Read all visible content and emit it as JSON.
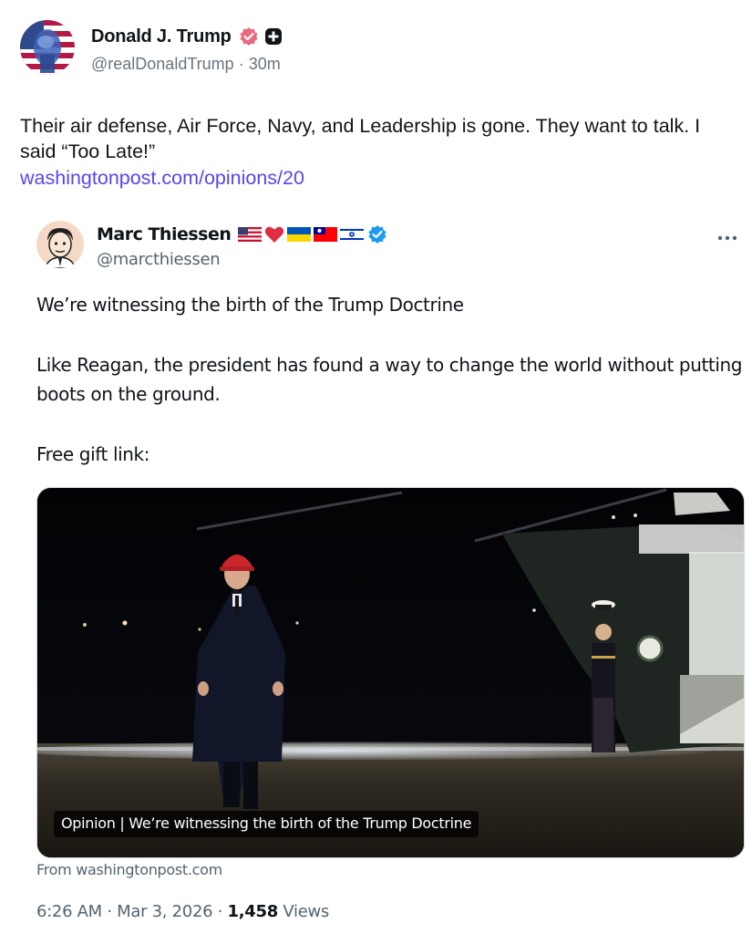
{
  "truth_post": {
    "author_name": "Donald J. Trump",
    "handle": "@realDonaldTrump",
    "separator": "·",
    "time_ago": "30m",
    "body": "Their air defense, Air Force, Navy, and Leadership is gone. They want to talk. I said “Too Late!”",
    "link_text": "washingtonpost.com/opinions/20",
    "icons": {
      "avatar": "flag-portrait-avatar",
      "verified": "verified-badge-icon",
      "extra": "plus-square-icon"
    },
    "colors": {
      "link": "#5448ee",
      "verified": "#e0245e"
    }
  },
  "quoted_post": {
    "author_name": "Marc Thiessen",
    "handle": "@marcthiessen",
    "flags": [
      "us-flag-icon",
      "red-heart-icon",
      "ukraine-flag-icon",
      "taiwan-flag-icon",
      "israel-flag-icon"
    ],
    "verified_icon": "blue-verified-icon",
    "more_icon": "more-horizontal-icon",
    "text_line_1": "We’re witnessing the birth of the Trump Doctrine",
    "text_line_2": "Like Reagan, the president has found a way to change the world without putting boots on the ground.",
    "text_line_3": "Free gift link:",
    "media_caption": "Opinion | We’re witnessing the birth of the Trump Doctrine",
    "media_source": "From washingtonpost.com",
    "time": "6:26 AM",
    "date": "Mar 3, 2026",
    "views_count": "1,458",
    "views_label": "Views",
    "colors": {
      "verified": "#1d9bf0"
    }
  }
}
